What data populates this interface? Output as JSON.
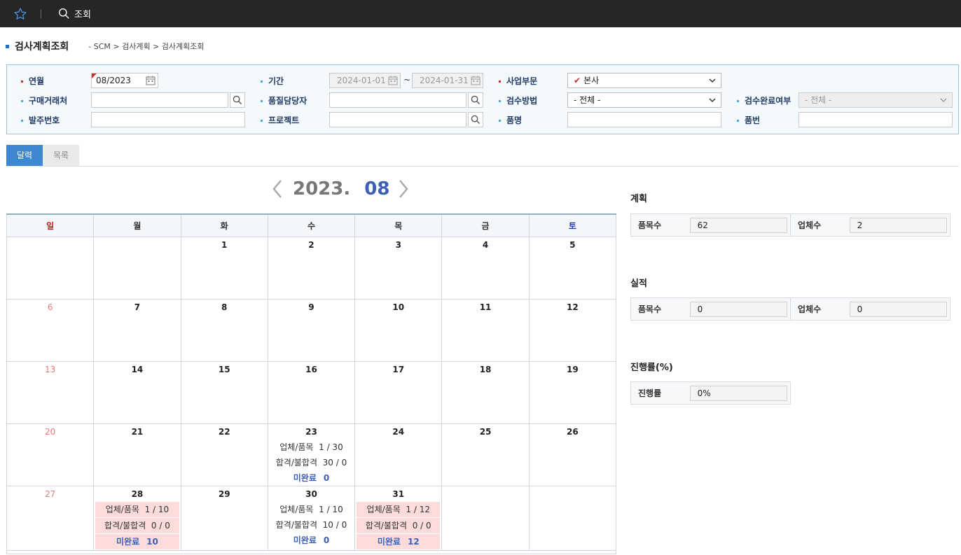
{
  "topbar": {
    "search_label": "조회"
  },
  "page": {
    "title": "검사계획조회",
    "breadcrumb": "- SCM > 검사계획 > 검사계획조회"
  },
  "filters": {
    "yearmonth_label": "연월",
    "yearmonth_value": "08/2023",
    "period_label": "기간",
    "period_from": "2024-01-01",
    "period_to": "2024-01-31",
    "period_sep": "~",
    "division_label": "사업부문",
    "division_value": "본사",
    "vendor_label": "구매거래처",
    "vendor_value": "",
    "qc_person_label": "품질담당자",
    "qc_person_value": "",
    "method_label": "검수방법",
    "method_value": "- 전체 -",
    "complete_label": "검수완료여부",
    "complete_value": "- 전체 -",
    "po_label": "발주번호",
    "po_value": "",
    "project_label": "프로젝트",
    "project_value": "",
    "item_name_label": "품명",
    "item_name_value": "",
    "item_no_label": "품번",
    "item_no_value": ""
  },
  "tabs": {
    "calendar": "달력",
    "list": "목록"
  },
  "calendar": {
    "year": "2023.",
    "month": "08",
    "weekdays": [
      "일",
      "월",
      "화",
      "수",
      "목",
      "금",
      "토"
    ],
    "row_labels": {
      "vendor_item": "업체/품목",
      "pass_fail": "합격/불합격",
      "incomplete": "미완료"
    },
    "days": {
      "1": "1",
      "2": "2",
      "3": "3",
      "4": "4",
      "5": "5",
      "6": "6",
      "7": "7",
      "8": "8",
      "9": "9",
      "10": "10",
      "11": "11",
      "12": "12",
      "13": "13",
      "14": "14",
      "15": "15",
      "16": "16",
      "17": "17",
      "18": "18",
      "19": "19",
      "20": "20",
      "21": "21",
      "22": "22",
      "23": "23",
      "24": "24",
      "25": "25",
      "26": "26",
      "27": "27",
      "28": "28",
      "29": "29",
      "30": "30",
      "31": "31"
    },
    "events": {
      "d23": {
        "vendor_item": "1 / 30",
        "pass_fail": "30 / 0",
        "incomplete": "0"
      },
      "d28": {
        "vendor_item": "1 / 10",
        "pass_fail": "0 / 0",
        "incomplete": "10"
      },
      "d30": {
        "vendor_item": "1 / 10",
        "pass_fail": "10 / 0",
        "incomplete": "0"
      },
      "d31": {
        "vendor_item": "1 / 12",
        "pass_fail": "0 / 0",
        "incomplete": "12"
      }
    }
  },
  "summary": {
    "plan": {
      "title": "계획",
      "items_label": "품목수",
      "items_value": "62",
      "vendors_label": "업체수",
      "vendors_value": "2"
    },
    "actual": {
      "title": "실적",
      "items_label": "품목수",
      "items_value": "0",
      "vendors_label": "업체수",
      "vendors_value": "0"
    },
    "progress": {
      "title": "진행률(%)",
      "label": "진행률",
      "value": "0%"
    }
  },
  "colors": {
    "topbar": "#262626",
    "accent": "#3d88d0",
    "month": "#3a5fb4",
    "highlight": "#fbdcda",
    "sunday": "#d11",
    "saturday": "#1c3fa8"
  }
}
